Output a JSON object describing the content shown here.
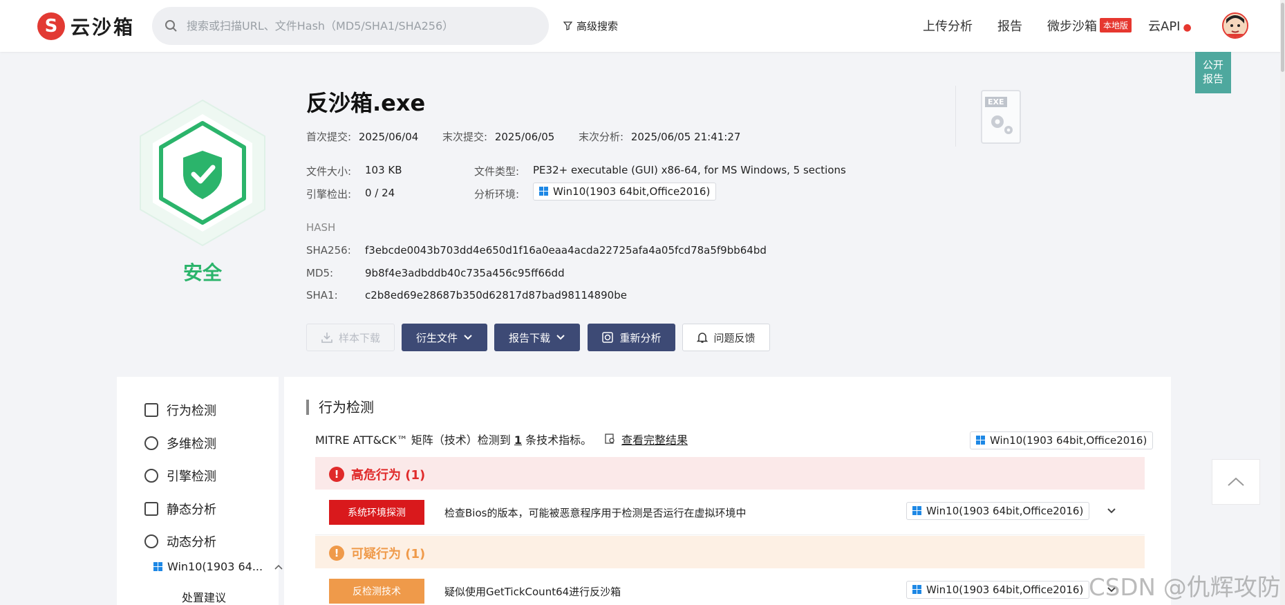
{
  "header": {
    "logo_mark": "S",
    "logo_text": "云沙箱",
    "search_placeholder": "搜索或扫描URL、文件Hash（MD5/SHA1/SHA256）",
    "advanced_search": "高级搜索",
    "nav": {
      "upload": "上传分析",
      "report": "报告",
      "sandbox": "微步沙箱",
      "sandbox_badge": "本地版",
      "api": "云API"
    }
  },
  "public_report": "公开\n报告",
  "summary": {
    "verdict": "安全",
    "verdict_color": "#2bb46b",
    "file_name": "反沙箱.exe",
    "first_submit_label": "首次提交:",
    "first_submit": "2025/06/04",
    "last_submit_label": "末次提交:",
    "last_submit": "2025/06/05",
    "last_analysis_label": "末次分析:",
    "last_analysis": "2025/06/05 21:41:27",
    "size_label": "文件大小:",
    "size": "103 KB",
    "type_label": "文件类型:",
    "type": "PE32+ executable (GUI) x86-64, for MS Windows, 5 sections",
    "engine_label": "引擎检出:",
    "engine": "0 / 24",
    "env_label": "分析环境:",
    "env": "Win10(1903 64bit,Office2016)",
    "hash_title": "HASH",
    "sha256_label": "SHA256:",
    "sha256": "f3ebcde0043b703dd4e650d1f16a0eaa4acda22725afa4a05fcd78a5f9bb64bd",
    "md5_label": "MD5:",
    "md5": "9b8f4e3adbddb40c735a456c95ff66dd",
    "sha1_label": "SHA1:",
    "sha1": "c2b8ed69e28687b350d62817d87bad98114890be",
    "file_icon_tag": "EXE"
  },
  "actions": {
    "download": "样本下载",
    "derived": "衍生文件",
    "report": "报告下载",
    "reanalyze": "重新分析",
    "feedback": "问题反馈"
  },
  "sidebar": {
    "items": [
      "行为检测",
      "多维检测",
      "引擎检测",
      "静态分析",
      "动态分析"
    ],
    "env": "Win10(1903 64...",
    "sub": "处置建议"
  },
  "main": {
    "title": "行为检测",
    "mitre_prefix": "MITRE ATT&CK™ 矩阵（技术）检测到",
    "mitre_count": "1",
    "mitre_suffix": "条技术指标。",
    "full_result": "查看完整结果",
    "env": "Win10(1903 64bit,Office2016)",
    "high_title": "高危行为 (1)",
    "high_color": "#e02a2a",
    "high_item_tag": "系统环境探测",
    "high_item_desc": "检查Bios的版本，可能被恶意程序用于检测是否运行在虚拟环境中",
    "sus_title": "可疑行为 (1)",
    "sus_color": "#ef9a4a",
    "sus_item_tag": "反检测技术",
    "sus_item_desc": "疑似使用GetTickCount64进行反沙箱"
  },
  "watermark": "CSDN @仇辉攻防"
}
